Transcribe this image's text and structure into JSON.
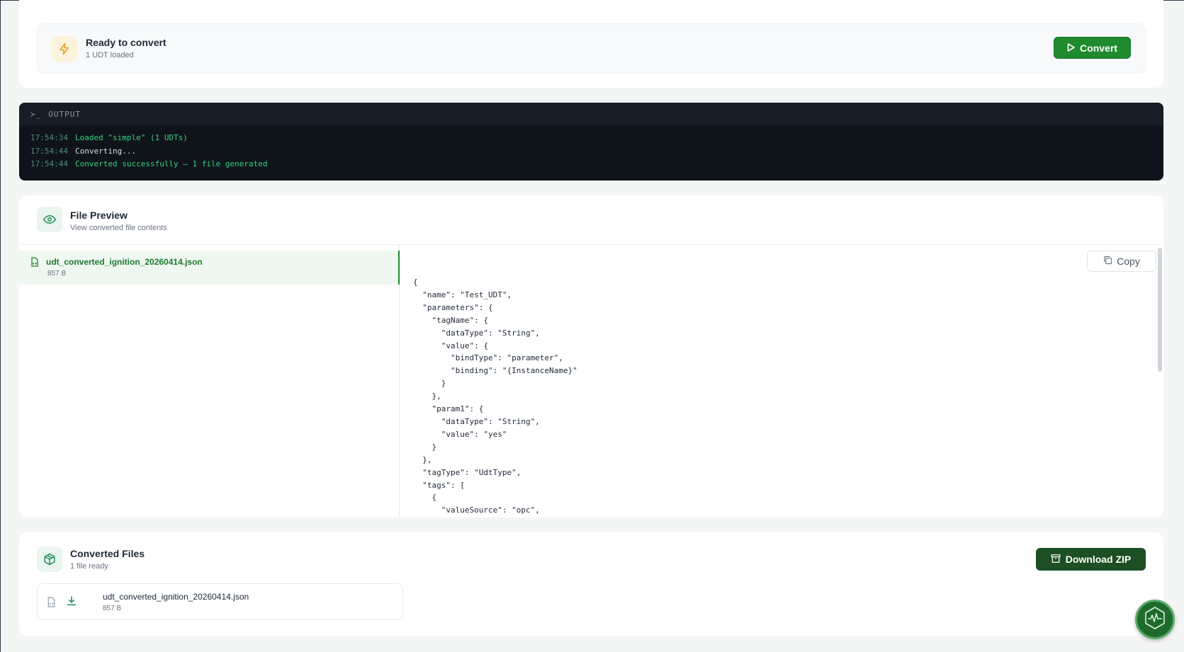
{
  "ready": {
    "title": "Ready to convert",
    "subtitle": "1 UDT loaded",
    "convert_label": "Convert",
    "icon": "bolt-icon"
  },
  "output": {
    "header": "OUTPUT",
    "prompt_glyph": "≻_",
    "lines": [
      {
        "time": "17:54:34",
        "message": "Loaded \"simple\" (1 UDTs)",
        "status": "success"
      },
      {
        "time": "17:54:44",
        "message": "Converting...",
        "status": "info"
      },
      {
        "time": "17:54:44",
        "message": "Converted successfully — 1 file generated",
        "status": "success"
      }
    ]
  },
  "preview": {
    "title": "File Preview",
    "subtitle": "View converted file contents",
    "file": {
      "name": "udt_converted_ignition_20260414.json",
      "size": "857 B"
    },
    "copy_label": "Copy",
    "code": "{\n  \"name\": \"Test_UDT\",\n  \"parameters\": {\n    \"tagName\": {\n      \"dataType\": \"String\",\n      \"value\": {\n        \"bindType\": \"parameter\",\n        \"binding\": \"{InstanceName}\"\n      }\n    },\n    \"param1\": {\n      \"dataType\": \"String\",\n      \"value\": \"yes\"\n    }\n  },\n  \"tagType\": \"UdtType\",\n  \"tags\": [\n    {\n      \"valueSource\": \"opc\","
  },
  "converted": {
    "title": "Converted Files",
    "subtitle": "1 file ready",
    "download_label": "Download ZIP",
    "file": {
      "name": "udt_converted_ignition_20260414.json",
      "size": "857 B"
    }
  },
  "colors": {
    "accent": "#1f8a2e",
    "dark_accent": "#1c4f23",
    "terminal_bg": "#0f141b"
  }
}
